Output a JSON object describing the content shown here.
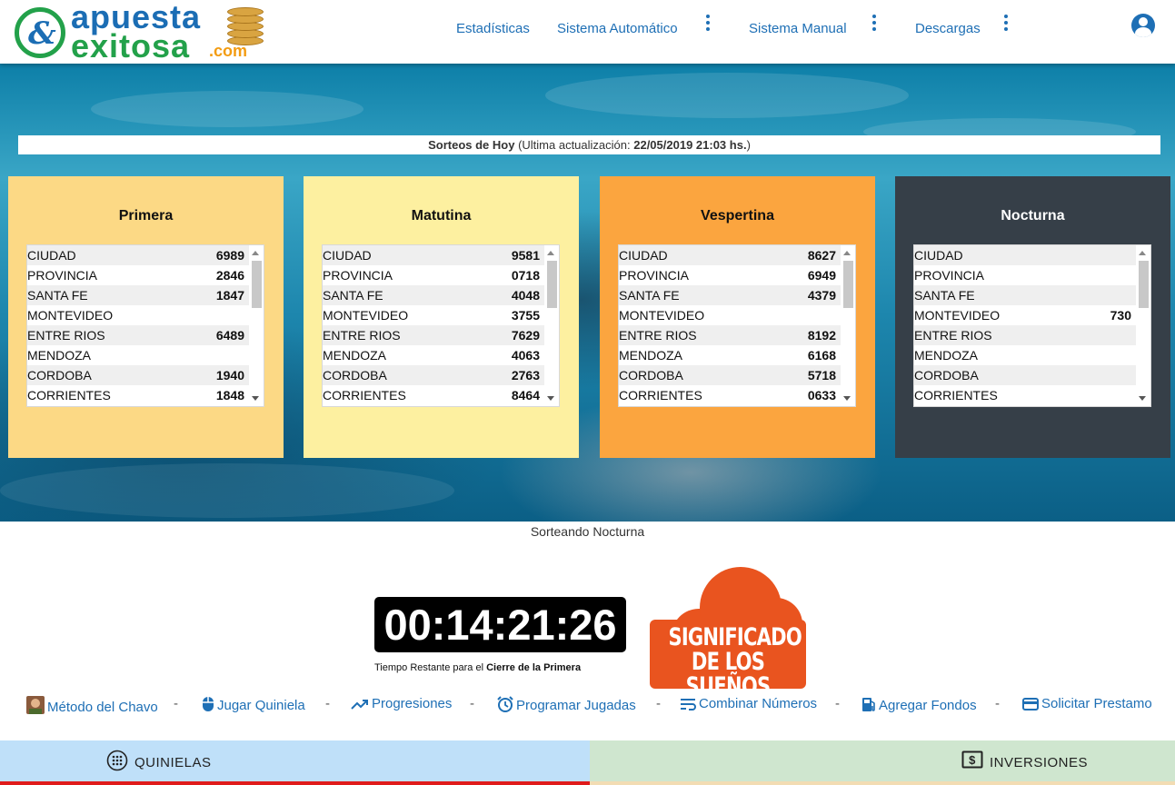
{
  "header": {
    "logo_line1": "apuesta",
    "logo_line2": "exitosa",
    "logo_suffix": ".com",
    "nav": [
      {
        "label": "Estadísticas"
      },
      {
        "label": "Sistema Automático"
      },
      {
        "label": "Sistema Manual"
      },
      {
        "label": "Descargas"
      }
    ],
    "icons": {
      "menu": "kebab-vertical-icon",
      "user": "account-circle-icon"
    }
  },
  "update_bar": {
    "label": "Sorteos de Hoy",
    "open": " (Ultima actualización: ",
    "datetime": "22/05/2019 21:03 hs.",
    "close": ")"
  },
  "draws": [
    {
      "title": "Primera",
      "color": "#fcd985",
      "title_color": "#111111",
      "rows": [
        {
          "name": "CIUDAD",
          "value": "6989"
        },
        {
          "name": "PROVINCIA",
          "value": "2846"
        },
        {
          "name": "SANTA FE",
          "value": "1847"
        },
        {
          "name": "MONTEVIDEO",
          "value": ""
        },
        {
          "name": "ENTRE RIOS",
          "value": "6489"
        },
        {
          "name": "MENDOZA",
          "value": ""
        },
        {
          "name": "CORDOBA",
          "value": "1940"
        },
        {
          "name": "CORRIENTES",
          "value": "1848"
        }
      ]
    },
    {
      "title": "Matutina",
      "color": "#fdf0a0",
      "title_color": "#111111",
      "rows": [
        {
          "name": "CIUDAD",
          "value": "9581"
        },
        {
          "name": "PROVINCIA",
          "value": "0718"
        },
        {
          "name": "SANTA FE",
          "value": "4048"
        },
        {
          "name": "MONTEVIDEO",
          "value": "3755"
        },
        {
          "name": "ENTRE RIOS",
          "value": "7629"
        },
        {
          "name": "MENDOZA",
          "value": "4063"
        },
        {
          "name": "CORDOBA",
          "value": "2763"
        },
        {
          "name": "CORRIENTES",
          "value": "8464"
        }
      ]
    },
    {
      "title": "Vespertina",
      "color": "#fba53f",
      "title_color": "#111111",
      "rows": [
        {
          "name": "CIUDAD",
          "value": "8627"
        },
        {
          "name": "PROVINCIA",
          "value": "6949"
        },
        {
          "name": "SANTA FE",
          "value": "4379"
        },
        {
          "name": "MONTEVIDEO",
          "value": ""
        },
        {
          "name": "ENTRE RIOS",
          "value": "8192"
        },
        {
          "name": "MENDOZA",
          "value": "6168"
        },
        {
          "name": "CORDOBA",
          "value": "5718"
        },
        {
          "name": "CORRIENTES",
          "value": "0633"
        }
      ]
    },
    {
      "title": "Nocturna",
      "color": "#363f48",
      "title_color": "#ffffff",
      "rows": [
        {
          "name": "CIUDAD",
          "value": ""
        },
        {
          "name": "PROVINCIA",
          "value": ""
        },
        {
          "name": "SANTA FE",
          "value": ""
        },
        {
          "name": "MONTEVIDEO",
          "value": "730"
        },
        {
          "name": "ENTRE RIOS",
          "value": ""
        },
        {
          "name": "MENDOZA",
          "value": ""
        },
        {
          "name": "CORDOBA",
          "value": ""
        },
        {
          "name": "CORRIENTES",
          "value": ""
        }
      ]
    }
  ],
  "status": "Sorteando Nocturna",
  "countdown": {
    "time": "00:14:21:26",
    "caption_prefix": "Tiempo Restante para el ",
    "caption_bold": "Cierre de la Primera"
  },
  "dreams_banner": {
    "line1": "SIGNIFICADO",
    "line2": "DE LOS SUEÑOS",
    "color": "#e9541f"
  },
  "links": [
    {
      "label": "Método del Chavo",
      "icon": "avatar-icon"
    },
    {
      "label": "Jugar Quiniela",
      "icon": "mouse-icon"
    },
    {
      "label": "Progresiones",
      "icon": "trending-up-icon"
    },
    {
      "label": "Programar Jugadas",
      "icon": "alarm-clock-icon"
    },
    {
      "label": "Combinar Números",
      "icon": "wrap-text-icon"
    },
    {
      "label": "Agregar Fondos",
      "icon": "fuel-pump-icon"
    },
    {
      "label": "Solicitar Prestamo",
      "icon": "credit-card-icon"
    }
  ],
  "link_separator": "-",
  "tabs": [
    {
      "label": "QUINIELAS",
      "icon": "dial-pad-icon",
      "color": "#bfe0f9"
    },
    {
      "label": "INVERSIONES",
      "icon": "dollar-box-icon",
      "color": "#cfe6cf"
    }
  ]
}
